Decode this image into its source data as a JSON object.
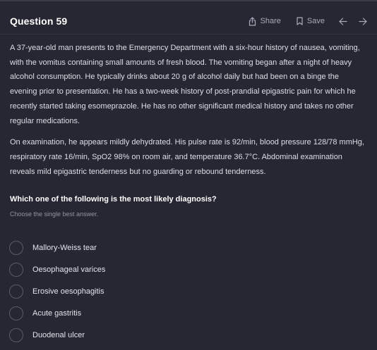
{
  "header": {
    "title": "Question 59",
    "share_label": "Share",
    "save_label": "Save"
  },
  "stem": {
    "paragraph1": "A 37-year-old man presents to the Emergency Department with a six-hour history of nausea, vomiting, with the vomitus containing small amounts of fresh blood. The vomiting began after a night of heavy alcohol consumption. He typically drinks about 20 g of alcohol daily but had been on a binge the evening prior to presentation. He has a two-week history of post-prandial epigastric pain for which he recently started taking esomeprazole. He has no other significant medical history and takes no other regular medications.",
    "paragraph2": "On examination, he appears mildly dehydrated. His pulse rate is 92/min, blood pressure 128/78 mmHg, respiratory rate 16/min, SpO2 98% on room air, and temperature 36.7°C. Abdominal examination reveals mild epigastric tenderness but no guarding or rebound tenderness."
  },
  "question": {
    "text": "Which one of the following is the most likely diagnosis?",
    "instruction": "Choose the single best answer."
  },
  "options": [
    {
      "label": "Mallory-Weiss tear"
    },
    {
      "label": "Oesophageal varices"
    },
    {
      "label": "Erosive oesophagitis"
    },
    {
      "label": "Acute gastritis"
    },
    {
      "label": "Duodenal ulcer"
    }
  ],
  "colors": {
    "background": "#272733",
    "text": "#e4e4ec",
    "muted": "#9292a6",
    "radio_border": "#5a5a6c"
  },
  "icons": {
    "share": "share-icon",
    "save": "bookmark-icon",
    "previous": "arrow-left-icon",
    "next": "arrow-right-icon"
  }
}
